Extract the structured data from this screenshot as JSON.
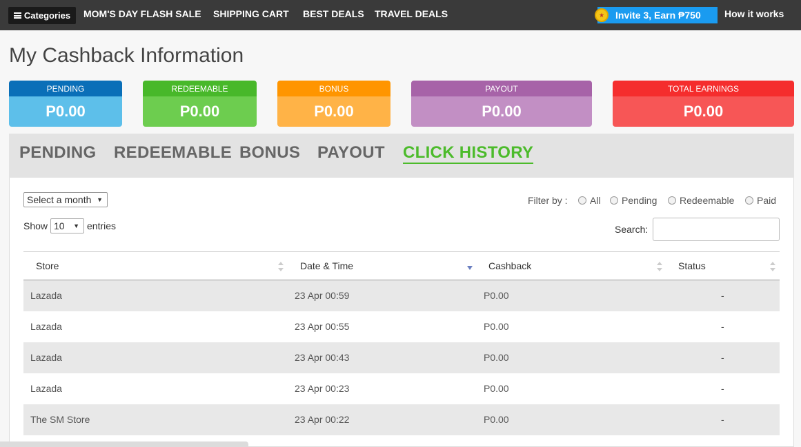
{
  "nav": {
    "categories_label": "Categories",
    "links": [
      "MOM'S DAY FLASH SALE",
      "SHIPPING CART",
      "BEST DEALS",
      "TRAVEL DEALS"
    ],
    "invite_label": "Invite 3, Earn ₱750",
    "how_label": "How it works"
  },
  "page_title": "My Cashback Information",
  "cards": [
    {
      "label": "PENDING",
      "amount": "P0.00",
      "head_color": "#0a6fb8",
      "body_color": "#5dbfea"
    },
    {
      "label": "REDEEMABLE",
      "amount": "P0.00",
      "head_color": "#48b82a",
      "body_color": "#6dcd4f"
    },
    {
      "label": "BONUS",
      "amount": "P0.00",
      "head_color": "#ff9500",
      "body_color": "#ffb347"
    },
    {
      "label": "PAYOUT",
      "amount": "P0.00",
      "head_color": "#a763a8",
      "body_color": "#c28fc4"
    },
    {
      "label": "TOTAL EARNINGS",
      "amount": "P0.00",
      "head_color": "#f52d2d",
      "body_color": "#f75656"
    }
  ],
  "tabs": [
    "PENDING",
    "REDEEMABLE",
    "BONUS",
    "PAYOUT",
    "CLICK HISTORY"
  ],
  "controls": {
    "month_select": "Select a month",
    "show_label": "Show",
    "entries_value": "10",
    "entries_label": "entries",
    "filter_label": "Filter by :",
    "filter_options": [
      "All",
      "Pending",
      "Redeemable",
      "Paid"
    ],
    "search_label": "Search:"
  },
  "table": {
    "headers": [
      "Store",
      "Date & Time",
      "Cashback",
      "Status"
    ],
    "rows": [
      [
        "Lazada",
        "23 Apr 00:59",
        "P0.00",
        "-"
      ],
      [
        "Lazada",
        "23 Apr 00:55",
        "P0.00",
        "-"
      ],
      [
        "Lazada",
        "23 Apr 00:43",
        "P0.00",
        "-"
      ],
      [
        "Lazada",
        "23 Apr 00:23",
        "P0.00",
        "-"
      ],
      [
        "The SM Store",
        "23 Apr 00:22",
        "P0.00",
        "-"
      ]
    ]
  },
  "colors": {
    "nav_bg": "#3a3a3a",
    "invite_bg": "#1a9bf0",
    "active_tab": "#4cbb2b"
  }
}
